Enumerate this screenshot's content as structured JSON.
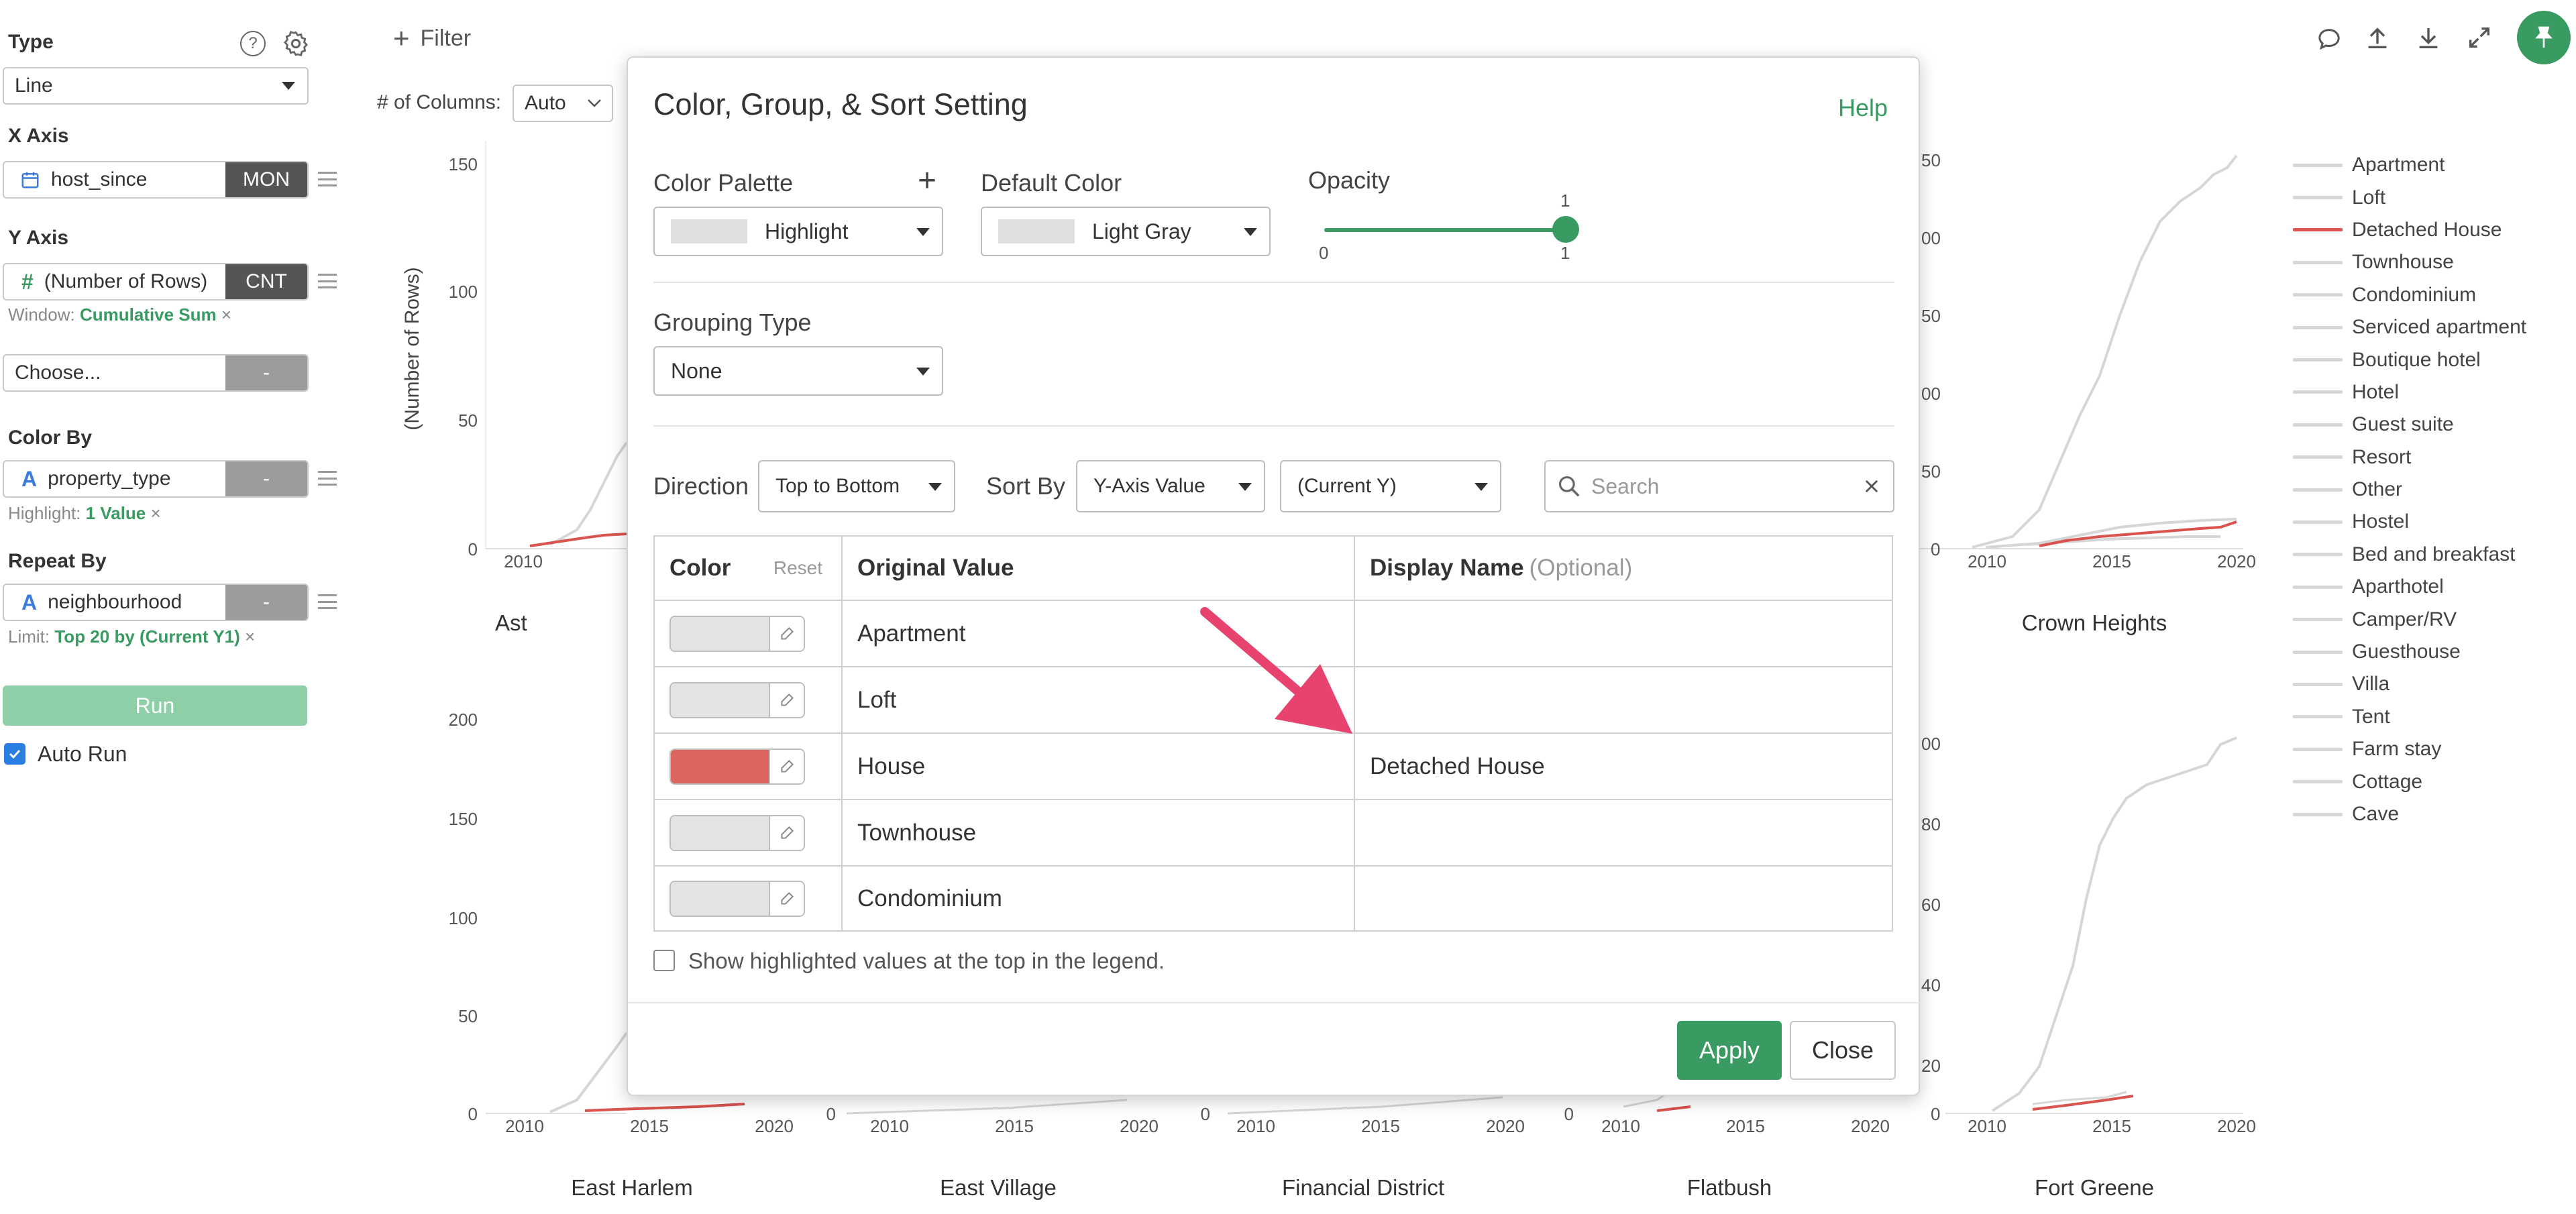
{
  "sidebar": {
    "type_label": "Type",
    "type_value": "Line",
    "x_axis_label": "X Axis",
    "x_axis_value": "host_since",
    "x_axis_tag": "MON",
    "y_axis_label": "Y Axis",
    "y_axis_value": "(Number of Rows)",
    "y_axis_tag": "CNT",
    "window_prefix": "Window:",
    "window_value": "Cumulative Sum",
    "choose_value": "Choose...",
    "choose_tag": "-",
    "color_by_label": "Color By",
    "color_by_value": "property_type",
    "color_by_tag": "-",
    "highlight_prefix": "Highlight:",
    "highlight_value": "1 Value",
    "repeat_by_label": "Repeat By",
    "repeat_by_value": "neighbourhood",
    "repeat_by_tag": "-",
    "limit_prefix": "Limit:",
    "limit_value": "Top 20 by (Current Y1)",
    "run_label": "Run",
    "auto_run_label": "Auto Run",
    "remove_glyph": "×"
  },
  "toolbar": {
    "filter_label": "Filter",
    "columns_label": "# of Columns:",
    "columns_value": "Auto"
  },
  "chart": {
    "y_axis_title": "(Number of Rows)",
    "top_row_titles": [
      "Ast",
      "Crown Heights"
    ],
    "bottom_row_titles": [
      "East Harlem",
      "East Village",
      "Financial District",
      "Flatbush",
      "Fort Greene"
    ]
  },
  "legend": [
    "Apartment",
    "Loft",
    "Detached House",
    "Townhouse",
    "Condominium",
    "Serviced apartment",
    "Boutique hotel",
    "Hotel",
    "Guest suite",
    "Resort",
    "Other",
    "Hostel",
    "Bed and breakfast",
    "Aparthotel",
    "Camper/RV",
    "Guesthouse",
    "Villa",
    "Tent",
    "Farm stay",
    "Cottage",
    "Cave"
  ],
  "colors": {
    "accent": "#3a9b62",
    "highlight": "#d9534f",
    "muted_line": "#d6d6d6",
    "arrow": "#e8436e"
  },
  "modal": {
    "title": "Color, Group, & Sort Setting",
    "help": "Help",
    "color_palette_label": "Color Palette",
    "color_palette_value": "Highlight",
    "default_color_label": "Default Color",
    "default_color_value": "Light Gray",
    "opacity_label": "Opacity",
    "opacity_value": "1",
    "opacity_min": "0",
    "opacity_max": "1",
    "grouping_type_label": "Grouping Type",
    "grouping_type_value": "None",
    "direction_label": "Direction",
    "direction_value": "Top to Bottom",
    "sort_by_label": "Sort By",
    "sort_by_value": "Y-Axis Value",
    "sort_target_value": "(Current Y)",
    "search_placeholder": "Search",
    "table": {
      "col_color": "Color",
      "col_reset": "Reset",
      "col_original": "Original Value",
      "col_display": "Display Name",
      "col_display_optional": "(Optional)",
      "rows": [
        {
          "original": "Apartment",
          "display": "",
          "color": "#e3e3e3"
        },
        {
          "original": "Loft",
          "display": "",
          "color": "#e3e3e3"
        },
        {
          "original": "House",
          "display": "Detached House",
          "color": "#dc6560"
        },
        {
          "original": "Townhouse",
          "display": "",
          "color": "#e3e3e3"
        },
        {
          "original": "Condominium",
          "display": "",
          "color": "#e3e3e3"
        }
      ]
    },
    "show_highlighted_label": "Show highlighted values at the top in the legend.",
    "apply_label": "Apply",
    "close_label": "Close"
  }
}
